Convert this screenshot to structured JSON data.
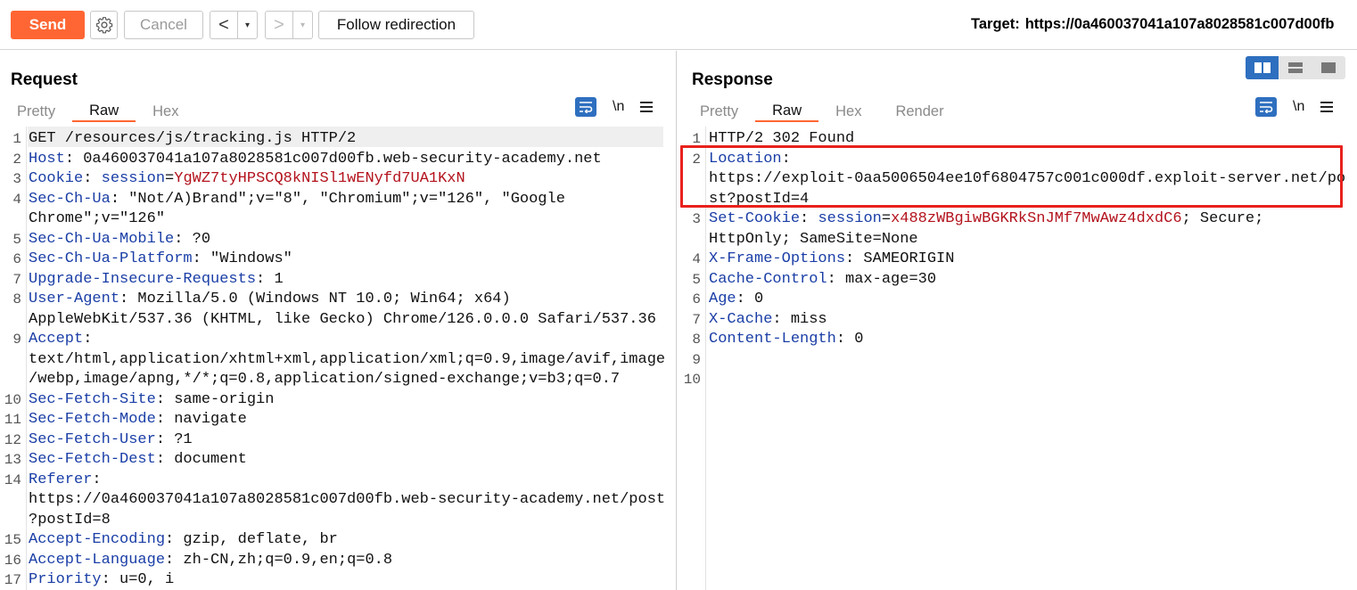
{
  "toolbar": {
    "send_label": "Send",
    "cancel_label": "Cancel",
    "back_arrow": "<",
    "forward_arrow": ">",
    "dropdown_glyph": "▾",
    "follow_label": "Follow redirection",
    "target_label": "Target:",
    "target_value": "https://0a460037041a107a8028581c007d00fb"
  },
  "request": {
    "title": "Request",
    "tabs": [
      "Pretty",
      "Raw",
      "Hex"
    ],
    "active_tab": "Raw",
    "newline_label": "\\n",
    "lines": [
      {
        "n": "1",
        "segs": [
          [
            "t",
            "GET /resources/js/tracking.js HTTP/2"
          ]
        ]
      },
      {
        "n": "2",
        "segs": [
          [
            "k",
            "Host"
          ],
          [
            "t",
            ": 0a460037041a107a8028581c007d00fb.web-security-academy.net"
          ]
        ]
      },
      {
        "n": "3",
        "segs": [
          [
            "k",
            "Cookie"
          ],
          [
            "t",
            ": "
          ],
          [
            "k",
            "session"
          ],
          [
            "t",
            "="
          ],
          [
            "v",
            "YgWZ7tyHPSCQ8kNISl1wENyfd7UA1KxN"
          ]
        ]
      },
      {
        "n": "4",
        "segs": [
          [
            "k",
            "Sec-Ch-Ua"
          ],
          [
            "t",
            ": \"Not/A)Brand\";v=\"8\", \"Chromium\";v=\"126\", \"Google"
          ]
        ]
      },
      {
        "n": "",
        "segs": [
          [
            "t",
            "Chrome\";v=\"126\""
          ]
        ]
      },
      {
        "n": "5",
        "segs": [
          [
            "k",
            "Sec-Ch-Ua-Mobile"
          ],
          [
            "t",
            ": ?0"
          ]
        ]
      },
      {
        "n": "6",
        "segs": [
          [
            "k",
            "Sec-Ch-Ua-Platform"
          ],
          [
            "t",
            ": \"Windows\""
          ]
        ]
      },
      {
        "n": "7",
        "segs": [
          [
            "k",
            "Upgrade-Insecure-Requests"
          ],
          [
            "t",
            ": 1"
          ]
        ]
      },
      {
        "n": "8",
        "segs": [
          [
            "k",
            "User-Agent"
          ],
          [
            "t",
            ": Mozilla/5.0 (Windows NT 10.0; Win64; x64)"
          ]
        ]
      },
      {
        "n": "",
        "segs": [
          [
            "t",
            "AppleWebKit/537.36 (KHTML, like Gecko) Chrome/126.0.0.0 Safari/537.36"
          ]
        ]
      },
      {
        "n": "9",
        "segs": [
          [
            "k",
            "Accept"
          ],
          [
            "t",
            ":"
          ]
        ]
      },
      {
        "n": "",
        "segs": [
          [
            "t",
            "text/html,application/xhtml+xml,application/xml;q=0.9,image/avif,image"
          ]
        ]
      },
      {
        "n": "",
        "segs": [
          [
            "t",
            "/webp,image/apng,*/*;q=0.8,application/signed-exchange;v=b3;q=0.7"
          ]
        ]
      },
      {
        "n": "10",
        "segs": [
          [
            "k",
            "Sec-Fetch-Site"
          ],
          [
            "t",
            ": same-origin"
          ]
        ]
      },
      {
        "n": "11",
        "segs": [
          [
            "k",
            "Sec-Fetch-Mode"
          ],
          [
            "t",
            ": navigate"
          ]
        ]
      },
      {
        "n": "12",
        "segs": [
          [
            "k",
            "Sec-Fetch-User"
          ],
          [
            "t",
            ": ?1"
          ]
        ]
      },
      {
        "n": "13",
        "segs": [
          [
            "k",
            "Sec-Fetch-Dest"
          ],
          [
            "t",
            ": document"
          ]
        ]
      },
      {
        "n": "14",
        "segs": [
          [
            "k",
            "Referer"
          ],
          [
            "t",
            ":"
          ]
        ]
      },
      {
        "n": "",
        "segs": [
          [
            "t",
            "https://0a460037041a107a8028581c007d00fb.web-security-academy.net/post"
          ]
        ]
      },
      {
        "n": "",
        "segs": [
          [
            "t",
            "?postId=8"
          ]
        ]
      },
      {
        "n": "15",
        "segs": [
          [
            "k",
            "Accept-Encoding"
          ],
          [
            "t",
            ": gzip, deflate, br"
          ]
        ]
      },
      {
        "n": "16",
        "segs": [
          [
            "k",
            "Accept-Language"
          ],
          [
            "t",
            ": zh-CN,zh;q=0.9,en;q=0.8"
          ]
        ]
      },
      {
        "n": "17",
        "segs": [
          [
            "k",
            "Priority"
          ],
          [
            "t",
            ": u=0, i"
          ]
        ]
      }
    ]
  },
  "response": {
    "title": "Response",
    "tabs": [
      "Pretty",
      "Raw",
      "Hex",
      "Render"
    ],
    "active_tab": "Raw",
    "newline_label": "\\n",
    "lines": [
      {
        "n": "1",
        "segs": [
          [
            "t",
            "HTTP/2 302 Found"
          ]
        ]
      },
      {
        "n": "2",
        "segs": [
          [
            "k",
            "Location"
          ],
          [
            "t",
            ":"
          ]
        ]
      },
      {
        "n": "",
        "segs": [
          [
            "t",
            "https://exploit-0aa5006504ee10f6804757c001c000df.exploit-server.net/po"
          ]
        ]
      },
      {
        "n": "",
        "segs": [
          [
            "t",
            "st?postId=4"
          ]
        ]
      },
      {
        "n": "3",
        "segs": [
          [
            "k",
            "Set-Cookie"
          ],
          [
            "t",
            ": "
          ],
          [
            "k",
            "session"
          ],
          [
            "t",
            "="
          ],
          [
            "v",
            "x488zWBgiwBGKRkSnJMf7MwAwz4dxdC6"
          ],
          [
            "t",
            "; Secure;"
          ]
        ]
      },
      {
        "n": "",
        "segs": [
          [
            "t",
            "HttpOnly; SameSite=None"
          ]
        ]
      },
      {
        "n": "4",
        "segs": [
          [
            "k",
            "X-Frame-Options"
          ],
          [
            "t",
            ": SAMEORIGIN"
          ]
        ]
      },
      {
        "n": "5",
        "segs": [
          [
            "k",
            "Cache-Control"
          ],
          [
            "t",
            ": max-age=30"
          ]
        ]
      },
      {
        "n": "6",
        "segs": [
          [
            "k",
            "Age"
          ],
          [
            "t",
            ": 0"
          ]
        ]
      },
      {
        "n": "7",
        "segs": [
          [
            "k",
            "X-Cache"
          ],
          [
            "t",
            ": miss"
          ]
        ]
      },
      {
        "n": "8",
        "segs": [
          [
            "k",
            "Content-Length"
          ],
          [
            "t",
            ": 0"
          ]
        ]
      },
      {
        "n": "9",
        "segs": []
      },
      {
        "n": "10",
        "segs": []
      }
    ]
  },
  "colors": {
    "accent": "#ff6633",
    "header_key": "#1a3ea6",
    "header_value": "#b3121c",
    "highlight_box": "#e8211d",
    "toggle_active": "#2e6fbf"
  }
}
